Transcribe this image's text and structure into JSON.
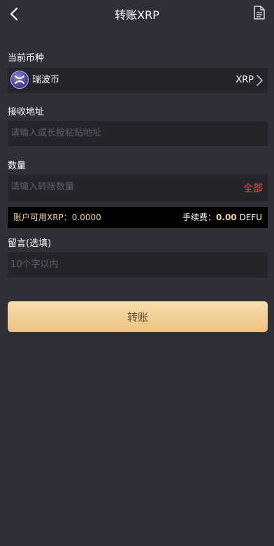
{
  "header": {
    "title": "转账XRP"
  },
  "coin": {
    "label": "当前币种",
    "name": "瑞波币",
    "code": "XRP"
  },
  "address": {
    "label": "接收地址",
    "placeholder": "请输入或长按粘贴地址"
  },
  "amount": {
    "label": "数量",
    "placeholder": "请输入转账数量",
    "all_label": "全部"
  },
  "balance_bar": {
    "available": "账户可用XRP：0.0000",
    "fee_label": "手续费：",
    "fee_value": "0.00",
    "fee_unit": "DEFU"
  },
  "memo": {
    "label": "留言(选填)",
    "placeholder": "10个字以内"
  },
  "submit_label": "转账",
  "colors": {
    "background": "#2f2f38",
    "field": "#24242b",
    "accent_red": "#f04a3f",
    "gold_text": "#f3d488",
    "button_gradient_top": "#f8deae",
    "button_gradient_bottom": "#edc27f"
  },
  "icons": [
    "back-arrow-icon",
    "record-document-icon",
    "xrp-coin-icon",
    "chevron-right-icon"
  ]
}
